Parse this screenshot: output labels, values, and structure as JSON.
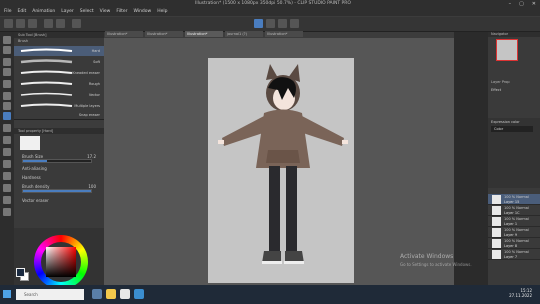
{
  "window": {
    "title": "Illustration* (1500 x 1080px 350dpi 50.7%) - CLIP STUDIO PAINT PRO",
    "controls": [
      "–",
      "▢",
      "✕"
    ]
  },
  "menu": [
    "File",
    "Edit",
    "Animation",
    "Layer",
    "Select",
    "View",
    "Filter",
    "Window",
    "Help"
  ],
  "doc_tabs": [
    "Illustration*",
    "Illustration*",
    "Illustration*",
    "journal1 (?)",
    "Illustration*"
  ],
  "subtool": {
    "header": "Sub Tool [Brush]",
    "group": "Brush",
    "brushes": [
      "Hard",
      "Soft",
      "Kneaded eraser",
      "Rough",
      "Vector",
      "Multiple layers",
      "Snap eraser"
    ]
  },
  "tool_property": {
    "header": "Tool property [Hard]",
    "brush_size_label": "Brush Size",
    "brush_size_value": "17.2",
    "brush_size_fraction": 0.35,
    "anti_aliasing_label": "Anti-aliasing",
    "hardness_label": "Hardness",
    "brush_density_label": "Brush density",
    "brush_density_value": "100",
    "brush_density_fraction": 1.0,
    "vector_eraser_label": "Vector eraser"
  },
  "navigator": {
    "header": "Navigator"
  },
  "layer_property": {
    "header": "Layer Prop",
    "effect": "Effect"
  },
  "expression_color": {
    "label": "Expression color",
    "value": "Color"
  },
  "layers": [
    {
      "blend": "100 % Normal",
      "name": "Layer 15"
    },
    {
      "blend": "100 % Normal",
      "name": "Layer 1C"
    },
    {
      "blend": "100 % Normal",
      "name": "Layer 1"
    },
    {
      "blend": "100 % Normal",
      "name": "Layer 9"
    },
    {
      "blend": "100 % Normal",
      "name": "Layer 8"
    },
    {
      "blend": "100 % Normal",
      "name": "Layer 7"
    }
  ],
  "taskbar": {
    "search_placeholder": "Search",
    "time": "15:12",
    "date": "27.11.2022"
  },
  "watermark": {
    "line1": "Activate Windows",
    "line2": "Go to Settings to activate Windows."
  },
  "colors": {
    "accent": "#4a7dbf",
    "selected_layer": "#4a5d7a",
    "foreground": "#1a2a40",
    "background": "#ffffff"
  }
}
